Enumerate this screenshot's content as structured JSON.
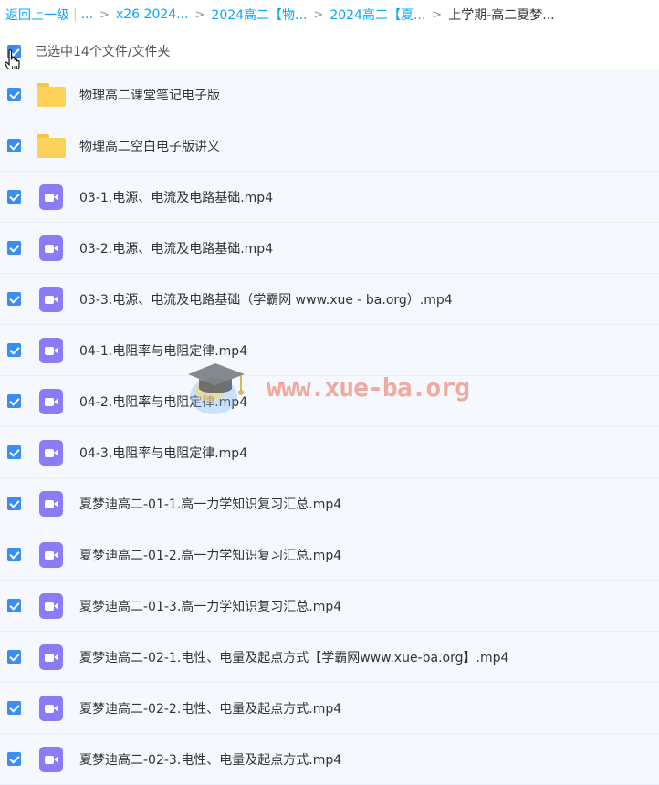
{
  "breadcrumb": {
    "back": "返回上一级",
    "ellipsis": "...",
    "items": [
      "x26 2024...",
      "2024高二【物...",
      "2024高二【夏...",
      "上学期-高二夏梦..."
    ],
    "separator": ">"
  },
  "selection": {
    "label": "已选中14个文件/文件夹",
    "checked": true
  },
  "files": [
    {
      "name": "物理高二课堂笔记电子版",
      "type": "folder"
    },
    {
      "name": "物理高二空白电子版讲义",
      "type": "folder"
    },
    {
      "name": "03-1.电源、电流及电路基础.mp4",
      "type": "video"
    },
    {
      "name": "03-2.电源、电流及电路基础.mp4",
      "type": "video"
    },
    {
      "name": "03-3.电源、电流及电路基础（学霸网 www.xue - ba.org）.mp4",
      "type": "video"
    },
    {
      "name": "04-1.电阻率与电阻定律.mp4",
      "type": "video"
    },
    {
      "name": "04-2.电阻率与电阻定律.mp4",
      "type": "video"
    },
    {
      "name": "04-3.电阻率与电阻定律.mp4",
      "type": "video"
    },
    {
      "name": "夏梦迪高二-01-1.高一力学知识复习汇总.mp4",
      "type": "video"
    },
    {
      "name": "夏梦迪高二-01-2.高一力学知识复习汇总.mp4",
      "type": "video"
    },
    {
      "name": "夏梦迪高二-01-3.高一力学知识复习汇总.mp4",
      "type": "video"
    },
    {
      "name": "夏梦迪高二-02-1.电性、电量及起点方式【学霸网www.xue-ba.org】.mp4",
      "type": "video"
    },
    {
      "name": "夏梦迪高二-02-2.电性、电量及起点方式.mp4",
      "type": "video"
    },
    {
      "name": "夏梦迪高二-02-3.电性、电量及起点方式.mp4",
      "type": "video"
    }
  ],
  "watermark": {
    "text": "www.xue-ba.org"
  },
  "colors": {
    "link": "#06a7ff",
    "checkbox": "#3b8df2",
    "row_bg": "#f5f9ff",
    "video_icon": "#8b7cf6",
    "folder_icon": "#fcd35a"
  }
}
